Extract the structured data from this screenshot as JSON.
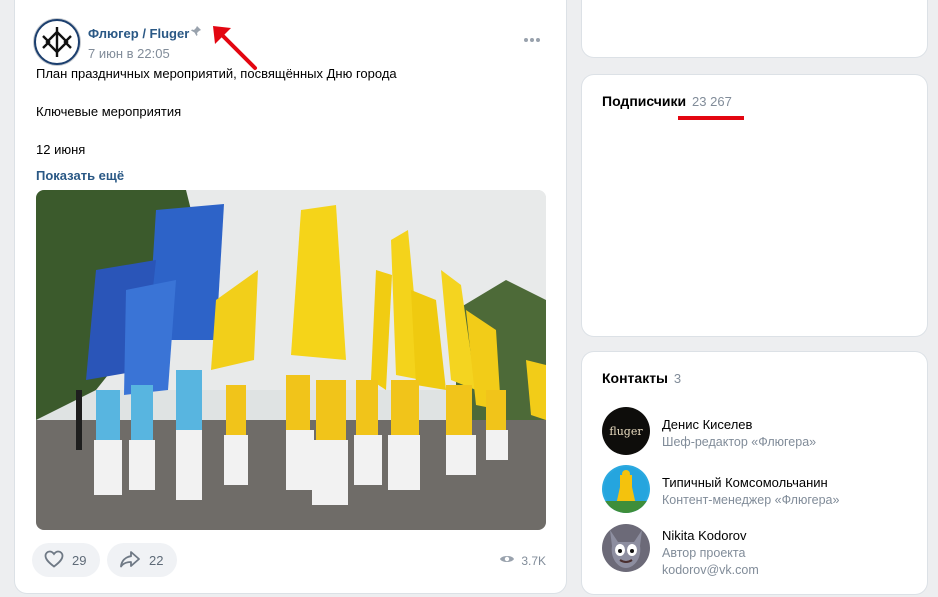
{
  "post": {
    "author": "Флюгер / Fluger",
    "date": "7 июн в 22:05",
    "lines": [
      "План праздничных мероприятий, посвящённых Дню города",
      "Ключевые мероприятия",
      "12 июня"
    ],
    "show_more": "Показать ещё",
    "likes": "29",
    "shares": "22",
    "views": "3.7K",
    "icons": {
      "pin": "pin-icon",
      "like": "heart-icon",
      "share": "share-icon",
      "views": "eye-icon",
      "more": "more-dots-icon"
    }
  },
  "subscribers": {
    "title": "Подписчики",
    "count": "23 267"
  },
  "contacts": {
    "title": "Контакты",
    "count": "3",
    "items": [
      {
        "name": "Денис Киселев",
        "role": "Шеф-редактор «Флюгера»",
        "avatar_text": "fluger"
      },
      {
        "name": "Типичный Комсомольчанин",
        "role": "Контент-менеджер «Флюгера»"
      },
      {
        "name": "Nikita Kodorov",
        "role": "Автор проекта",
        "email": "kodorov@vk.com"
      }
    ]
  },
  "colors": {
    "link": "#2a5885",
    "muted": "#818c99",
    "annotation": "#e30611"
  }
}
